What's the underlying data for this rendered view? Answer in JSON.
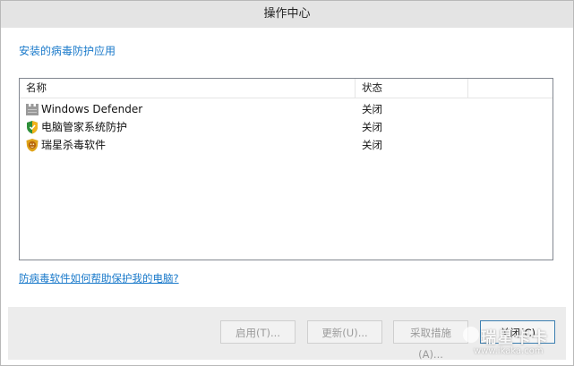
{
  "window": {
    "title": "操作中心"
  },
  "section": {
    "heading": "安装的病毒防护应用"
  },
  "list": {
    "columns": [
      "名称",
      "状态",
      ""
    ],
    "rows": [
      {
        "name": "Windows Defender",
        "status": "关闭",
        "icon": "windows-defender-icon"
      },
      {
        "name": "电脑管家系统防护",
        "status": "关闭",
        "icon": "shield-icon"
      },
      {
        "name": "瑞星杀毒软件",
        "status": "关闭",
        "icon": "lion-icon"
      }
    ]
  },
  "help_link": "防病毒软件如何帮助保护我的电脑?",
  "buttons": {
    "enable": "启用(T)...",
    "update": "更新(U)...",
    "action": "采取措施(A)...",
    "close": "关闭(C)"
  },
  "watermark": {
    "top": "瑞星卡卡",
    "bottom": "www.ikaka.com"
  },
  "colors": {
    "link": "#1979ca",
    "titlebar": "#e4e4e4",
    "footer": "#ececec",
    "primary_border": "#3c7fb1"
  }
}
